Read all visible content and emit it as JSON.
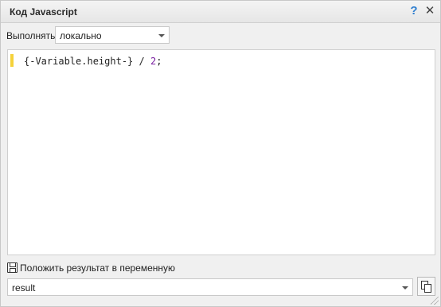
{
  "window": {
    "title": "Код Javascript",
    "help_glyph": "?",
    "close_glyph": "✕"
  },
  "execution": {
    "label": "Выполнять",
    "mode": "локально"
  },
  "editor": {
    "code_prefix": "{-Variable.height-} / ",
    "code_number": "2",
    "code_suffix": ";"
  },
  "output": {
    "save_label": "Положить результат в переменную",
    "variable": "result"
  },
  "icons": {
    "save": "save-icon",
    "copy": "copy-icon",
    "help": "help-icon",
    "close": "close-icon"
  },
  "colors": {
    "gutter_marker": "#f5d23a",
    "help_accent": "#2f7fd0",
    "number_literal": "#7a1ea1"
  }
}
